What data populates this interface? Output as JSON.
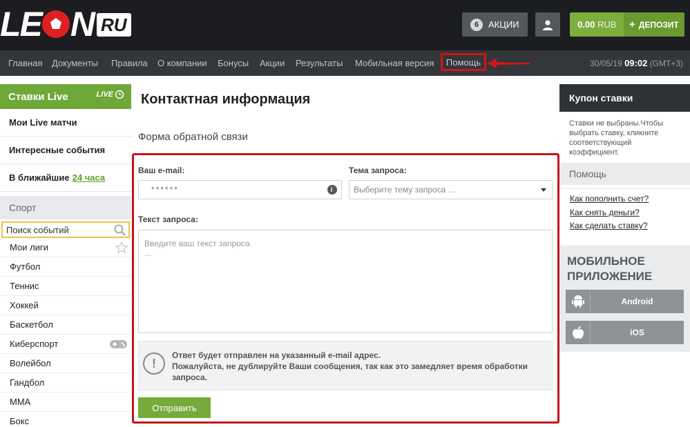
{
  "header": {
    "logo_text_1": "LE",
    "logo_text_2": "N",
    "logo_ru": "RU",
    "promo_count": "6",
    "promo_label": "АКЦИИ",
    "balance_amount": "0.00",
    "balance_currency": "RUB",
    "deposit_label": "ДЕПОЗИТ"
  },
  "nav": {
    "items": [
      "Главная",
      "Документы",
      "Правила",
      "О компании",
      "Бонусы",
      "Акции",
      "Результаты",
      "Мобильная версия"
    ],
    "help": "Помощь",
    "date": "30/05/19",
    "time": "09:02",
    "tz": "(GMT+3)"
  },
  "left": {
    "live_title": "Ставки Live",
    "live_badge": "LIVE",
    "links": [
      "Мои Live матчи",
      "Интересные события"
    ],
    "nearest_prefix": "В ближайшие",
    "nearest_link": "24 часа",
    "sport_title": "Спорт",
    "search_placeholder": "Поиск событий",
    "sports": [
      "Мои лиги",
      "Футбол",
      "Теннис",
      "Хоккей",
      "Баскетбол",
      "Киберспорт",
      "Волейбол",
      "Гандбол",
      "MMA",
      "Бокс"
    ]
  },
  "main": {
    "title": "Контактная информация",
    "subtitle": "Форма обратной связи",
    "email_label": "Ваш e-mail:",
    "email_value": "******",
    "topic_label": "Тема запроса:",
    "topic_placeholder": "Выберите тему запроса ...",
    "text_label": "Текст запроса:",
    "text_placeholder": "Введите ваш текст запроса",
    "text_placeholder_2": "...",
    "notice_line1": "Ответ будет отправлен на указанный e-mail адрес.",
    "notice_line2": "Пожалуйста, не дублируйте Ваши сообщения, так как это замедляет время обработки запроса.",
    "send_label": "Отправить"
  },
  "right": {
    "coupon_title": "Купон ставки",
    "coupon_text": "Ставки не выбраны.Чтобы выбрать ставку, кликните соответствующий коэффициент.",
    "help_title": "Помощь",
    "help_links": [
      "Как пополнить счет?",
      "Как снять деньги?",
      "Как сделать ставку?"
    ],
    "mobile_title_1": "МОБИЛЬНОЕ",
    "mobile_title_2": "ПРИЛОЖЕНИЕ",
    "android_label": "Android",
    "ios_label": "iOS"
  },
  "colors": {
    "accent_green": "#76ab3c",
    "highlight_red": "#c4151a",
    "header_dark": "#1b1d20"
  }
}
